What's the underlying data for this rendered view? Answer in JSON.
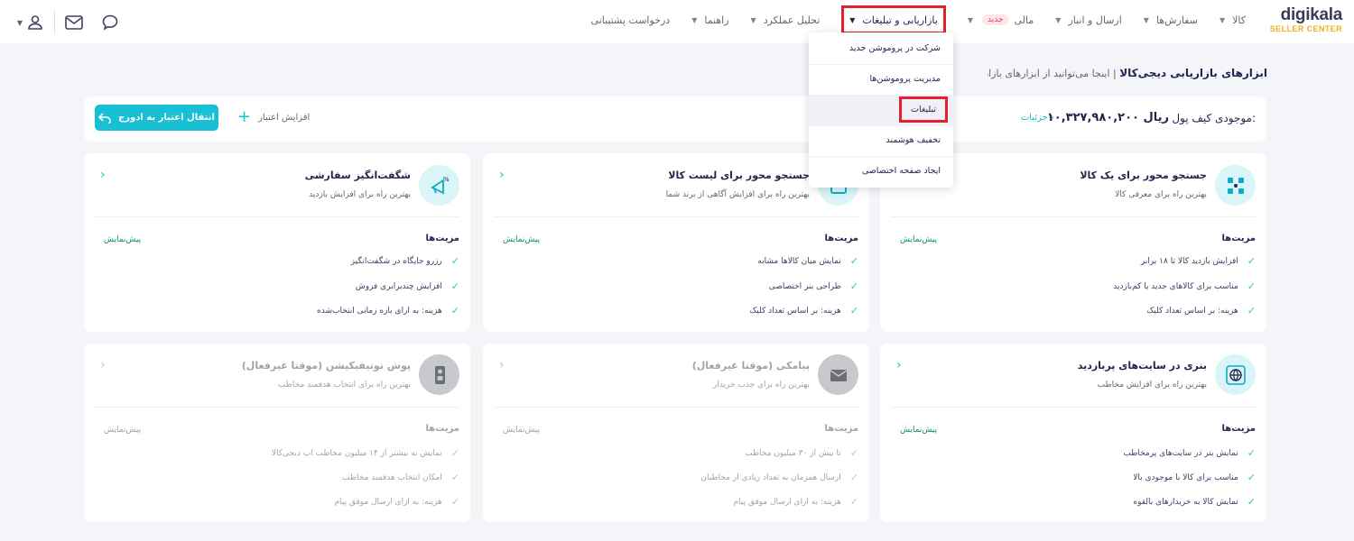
{
  "logo": {
    "brand": "digikala",
    "sub": "SELLER CENTER"
  },
  "nav": {
    "items": [
      {
        "label": "کالا",
        "active": false
      },
      {
        "label": "سفارش‌ها",
        "active": false
      },
      {
        "label": "ارسال و انبار",
        "active": false
      },
      {
        "label": "مالی",
        "badge": "جدید",
        "active": false
      },
      {
        "label": "بازاریابی و تبلیغات",
        "active": true
      },
      {
        "label": "تحلیل عملکرد",
        "active": false
      },
      {
        "label": "راهنما",
        "active": false
      },
      {
        "label": "درخواست پشتیبانی",
        "active": false
      }
    ]
  },
  "header_icons": [
    "chat-icon",
    "mail-icon",
    "user-icon",
    "caret-down-icon"
  ],
  "page": {
    "title": "ابزارهای بازاریابی دیجی‌کالا",
    "separator": "|",
    "description": "اینجا می‌توانید از ابزارهای بازاریابی دیجی‌کالا برای افز"
  },
  "wallet": {
    "label": "موجودی کیف پول:",
    "amount": "۱۰,۳۲۷,۹۸۰,۲۰۰ ریال",
    "details": "جزئیات ›",
    "add_credit": "افزایش اعتبار",
    "transfer": "انتقال اعتبار به ادورج"
  },
  "dropdown": {
    "items": [
      {
        "label": "شرکت در پروموشن جدید",
        "highlight": false
      },
      {
        "label": "مدیریت پروموشن‌ها",
        "highlight": false
      },
      {
        "label": "تبلیغات",
        "highlight": true
      },
      {
        "label": "تخفیف هوشمند",
        "highlight": false
      },
      {
        "label": "ایجاد صفحه اختصاصی",
        "highlight": false
      }
    ]
  },
  "cards": [
    {
      "title": "جستجو محور برای یک کالا",
      "subtitle": "بهترین راه برای معرفی کالا",
      "features_title": "مزیت‌ها",
      "preview": "پیش‌نمایش",
      "features": [
        "افزایش بازدید کالا تا ۱۸ برابر",
        "مناسب برای کالاهای جدید یا کم‌بازدید",
        "هزینه: بر اساس تعداد کلیک"
      ],
      "icon": "grid-target-icon",
      "disabled": false
    },
    {
      "title": "جستجو محور برای لیست کالا",
      "subtitle": "بهترین راه برای افزایش آگاهی از برند شما",
      "features_title": "مزیت‌ها",
      "preview": "پیش‌نمایش",
      "features": [
        "نمایش میان کالاها مشابه",
        "طراحی بنر اختصاصی",
        "هزینه: بر اساس تعداد کلیک"
      ],
      "icon": "list-icon",
      "disabled": false
    },
    {
      "title": "شگفت‌انگیز سفارشی",
      "subtitle": "بهترین راه برای افزایش بازدید",
      "features_title": "مزیت‌ها",
      "preview": "پیش‌نمایش",
      "features": [
        "رزرو جایگاه در شگفت‌انگیز",
        "افزایش چندبرابری فروش",
        "هزینه: به ازای بازه زمانی انتخاب‌شده"
      ],
      "icon": "megaphone-icon",
      "disabled": false
    },
    {
      "title": "بنری در سایت‌های پربازدید",
      "subtitle": "بهترین راه برای افزایش مخاطب",
      "features_title": "مزیت‌ها",
      "preview": "پیش‌نمایش",
      "features": [
        "نمایش بنر در سایت‌های پرمخاطب",
        "مناسب برای کالا با موجودی بالا",
        "نمایش کالا به خریدارهای بالقوه"
      ],
      "icon": "globe-icon",
      "disabled": false
    },
    {
      "title": "پیامکی (موقتا غیرفعال)",
      "subtitle": "بهترین راه برای جذب خریدار",
      "features_title": "مزیت‌ها",
      "preview": "پیش‌نمایش",
      "features": [
        "تا بیش از ۳۰ میلیون مخاطب",
        "ارسال همزمان به تعداد زیادی از مخاطبان",
        "هزینه: به ازای ارسال موفق پیام"
      ],
      "icon": "sms-icon",
      "disabled": true
    },
    {
      "title": "پوش نوتیفیکیشن (موقتا غیرفعال)",
      "subtitle": "بهترین راه برای انتخاب هدفمند مخاطب",
      "features_title": "مزیت‌ها",
      "preview": "پیش‌نمایش",
      "features": [
        "نمایش به بیشتر از ۱۴ میلیون مخاطب اپ دیجی‌کالا",
        "امکان انتخاب هدفمند مخاطب",
        "هزینه: به ازای ارسال موفق پیام"
      ],
      "icon": "phone-icon",
      "disabled": true
    }
  ]
}
